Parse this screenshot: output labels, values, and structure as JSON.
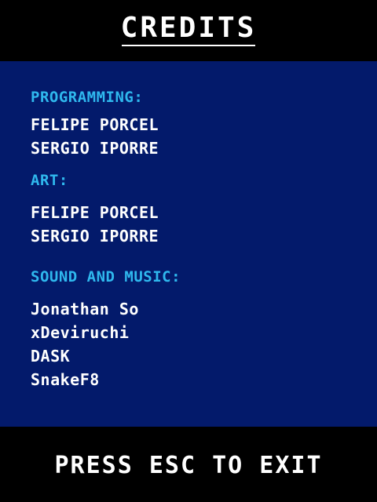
{
  "header": {
    "title": "CREDITS"
  },
  "sections": {
    "programming": {
      "heading": "PROGRAMMING:",
      "names": [
        "FELIPE PORCEL",
        "SERGIO IPORRE"
      ]
    },
    "art": {
      "heading": "ART:",
      "names": [
        "FELIPE PORCEL",
        "SERGIO IPORRE"
      ]
    },
    "sound": {
      "heading": "SOUND AND MUSIC:",
      "names": [
        "Jonathan So",
        "xDeviruchi",
        "DASK",
        "SnakeF8"
      ]
    }
  },
  "footer": {
    "prompt": "PRESS ESC TO EXIT"
  },
  "colors": {
    "background": "#000000",
    "panel": "#031a6b",
    "heading": "#2fb8ee",
    "text": "#ffffff"
  }
}
